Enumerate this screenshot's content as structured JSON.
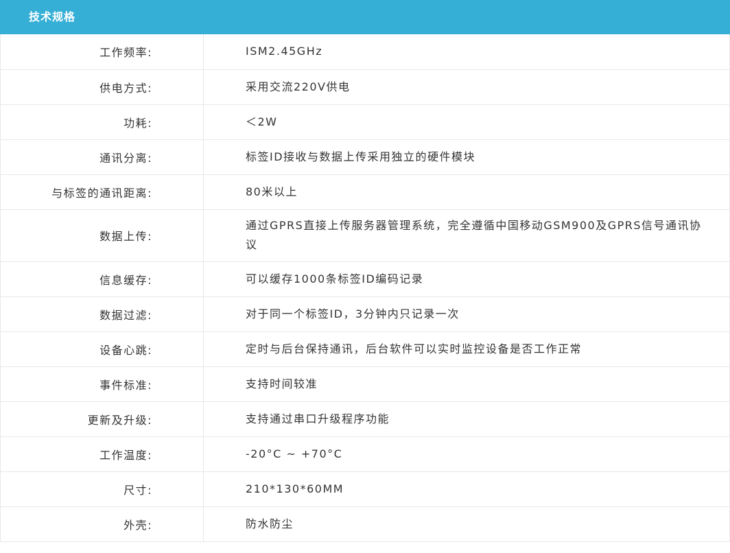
{
  "header": {
    "title": "技术规格"
  },
  "specs": [
    {
      "label": "工作频率:",
      "value": "ISM2.45GHz"
    },
    {
      "label": "供电方式:",
      "value": "采用交流220V供电"
    },
    {
      "label": "功耗:",
      "value": "＜2W"
    },
    {
      "label": "通讯分离:",
      "value": "标签ID接收与数据上传采用独立的硬件模块"
    },
    {
      "label": "与标签的通讯距离:",
      "value": "80米以上"
    },
    {
      "label": "数据上传:",
      "value": "通过GPRS直接上传服务器管理系统，完全遵循中国移动GSM900及GPRS信号通讯协议"
    },
    {
      "label": "信息缓存:",
      "value": "可以缓存1000条标签ID编码记录"
    },
    {
      "label": "数据过滤:",
      "value": "对于同一个标签ID，3分钟内只记录一次"
    },
    {
      "label": "设备心跳:",
      "value": "定时与后台保持通讯，后台软件可以实时监控设备是否工作正常"
    },
    {
      "label": "事件标准:",
      "value": "支持时间较准"
    },
    {
      "label": "更新及升级:",
      "value": "支持通过串口升级程序功能"
    },
    {
      "label": "工作温度:",
      "value": "-20°C ~ +70°C"
    },
    {
      "label": "尺寸:",
      "value": "210*130*60MM"
    },
    {
      "label": "外壳:",
      "value": "防水防尘"
    }
  ],
  "colors": {
    "header_bg": "#35afd6",
    "header_text": "#ffffff",
    "border": "#e8e8e8",
    "text": "#333333"
  }
}
